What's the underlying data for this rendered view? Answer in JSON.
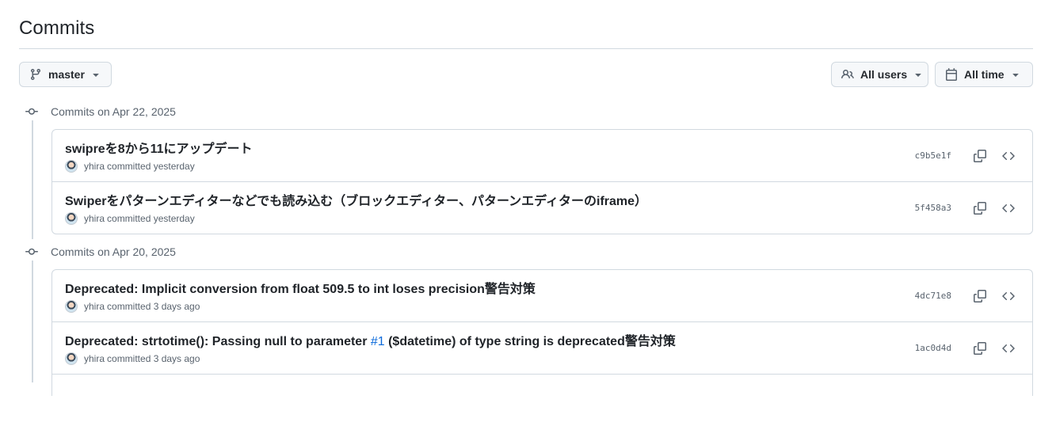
{
  "page": {
    "title": "Commits"
  },
  "filters": {
    "branch": {
      "label": "master",
      "icon": "git-branch-icon"
    },
    "users": {
      "label": "All users",
      "icon": "people-icon"
    },
    "time": {
      "label": "All time",
      "icon": "calendar-icon"
    }
  },
  "groups": [
    {
      "header": "Commits on Apr 22, 2025",
      "commits": [
        {
          "message": "swipreを8から11にアップデート",
          "author": "yhira",
          "meta": "committed yesterday",
          "sha": "c9b5e1f"
        },
        {
          "message": "Swiperをパターンエディターなどでも読み込む（ブロックエディター、パターンエディターのiframe）",
          "author": "yhira",
          "meta": "committed yesterday",
          "sha": "5f458a3"
        }
      ]
    },
    {
      "header": "Commits on Apr 20, 2025",
      "commits": [
        {
          "message": "Deprecated: Implicit conversion from float 509.5 to int loses precision警告対策",
          "author": "yhira",
          "meta": "committed 3 days ago",
          "sha": "4dc71e8"
        },
        {
          "message_before": "Deprecated: strtotime(): Passing null to parameter ",
          "message_link": "#1",
          "message_after": " ($datetime) of type string is deprecated警告対策",
          "author": "yhira",
          "meta": "committed 3 days ago",
          "sha": "1ac0d4d"
        }
      ]
    }
  ],
  "colors": {
    "link": "#0969da",
    "muted": "#59636e",
    "border": "#d1d9e0",
    "button_bg": "#f6f8fa"
  }
}
